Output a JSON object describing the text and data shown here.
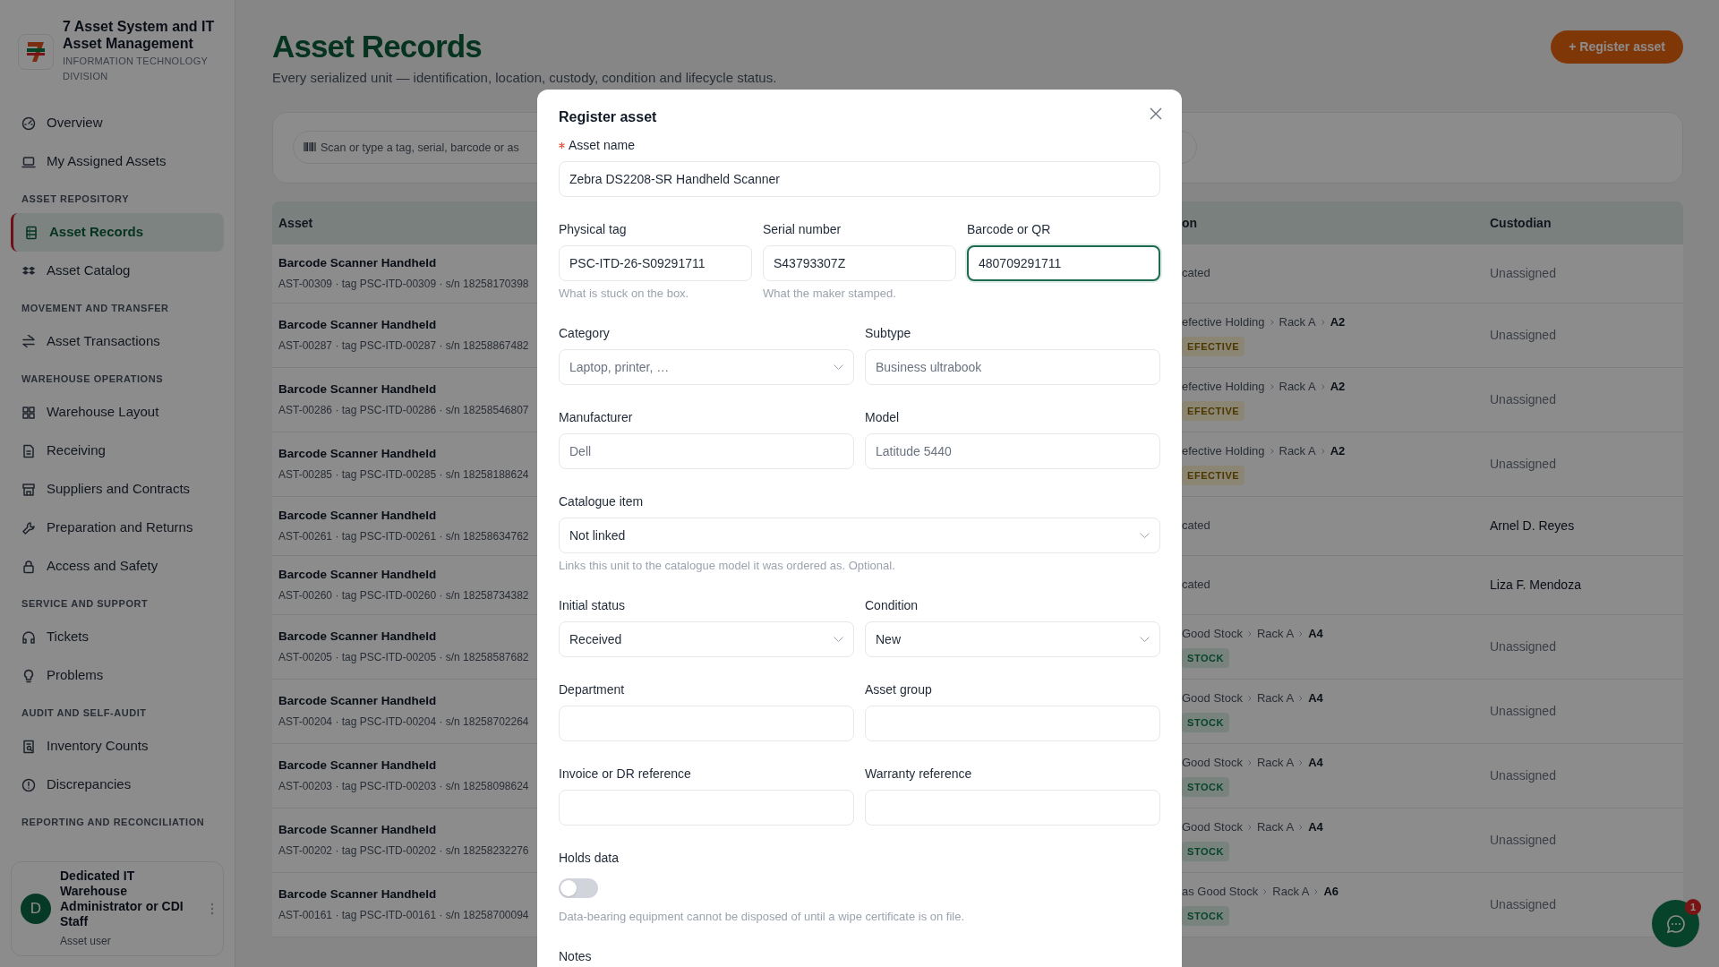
{
  "sidebar": {
    "brand": {
      "title": "7 Asset System and IT Asset Management",
      "subtitle": "INFORMATION TECHNOLOGY DIVISION"
    },
    "sections": [
      {
        "items": [
          {
            "label": "Overview",
            "selected": false
          },
          {
            "label": "My Assigned Assets",
            "selected": false
          }
        ]
      },
      {
        "heading": "ASSET REPOSITORY",
        "items": [
          {
            "label": "Asset Records",
            "selected": true
          },
          {
            "label": "Asset Catalog",
            "selected": false
          }
        ]
      },
      {
        "heading": "MOVEMENT AND TRANSFER",
        "items": [
          {
            "label": "Asset Transactions",
            "selected": false
          }
        ]
      },
      {
        "heading": "WAREHOUSE OPERATIONS",
        "items": [
          {
            "label": "Warehouse Layout",
            "selected": false
          },
          {
            "label": "Receiving",
            "selected": false
          },
          {
            "label": "Suppliers and Contracts",
            "selected": false
          },
          {
            "label": "Preparation and Returns",
            "selected": false
          },
          {
            "label": "Access and Safety",
            "selected": false
          }
        ]
      },
      {
        "heading": "SERVICE AND SUPPORT",
        "items": [
          {
            "label": "Tickets",
            "selected": false
          },
          {
            "label": "Problems",
            "selected": false
          }
        ]
      },
      {
        "heading": "AUDIT AND SELF-AUDIT",
        "items": [
          {
            "label": "Inventory Counts",
            "selected": false
          },
          {
            "label": "Discrepancies",
            "selected": false
          }
        ]
      },
      {
        "heading": "REPORTING AND RECONCILIATION"
      }
    ],
    "user": {
      "initial": "D",
      "name": "Dedicated IT Warehouse Administrator or CDI Staff",
      "role": "Asset user"
    }
  },
  "header": {
    "title": "Asset Records",
    "subtitle": "Every serialized unit — identification, location, custody, condition and lifecycle status.",
    "button": "+ Register asset"
  },
  "search": {
    "placeholder": "Scan or type a tag, serial, barcode or as"
  },
  "table": {
    "columns": [
      "Asset",
      "on",
      "Custodian"
    ],
    "rows": [
      {
        "name": "Barcode Scanner Handheld",
        "ids": "AST-00309 · tag PSC-ITD-00309 · s/n 18258170398",
        "location": [
          "cated"
        ],
        "custodian": "Unassigned",
        "assigned": false
      },
      {
        "name": "Barcode Scanner Handheld",
        "ids": "AST-00287 · tag PSC-ITD-00287 · s/n 18258867482",
        "location": [
          "efective Holding",
          "Rack A",
          "A2"
        ],
        "badge": {
          "text": "EFECTIVE",
          "kind": "defective"
        },
        "custodian": "Unassigned",
        "assigned": false
      },
      {
        "name": "Barcode Scanner Handheld",
        "ids": "AST-00286 · tag PSC-ITD-00286 · s/n 18258546807",
        "location": [
          "efective Holding",
          "Rack A",
          "A2"
        ],
        "badge": {
          "text": "EFECTIVE",
          "kind": "defective"
        },
        "custodian": "Unassigned",
        "assigned": false
      },
      {
        "name": "Barcode Scanner Handheld",
        "ids": "AST-00285 · tag PSC-ITD-00285 · s/n 18258188624",
        "location": [
          "efective Holding",
          "Rack A",
          "A2"
        ],
        "badge": {
          "text": "EFECTIVE",
          "kind": "defective"
        },
        "custodian": "Unassigned",
        "assigned": false
      },
      {
        "name": "Barcode Scanner Handheld",
        "ids": "AST-00261 · tag PSC-ITD-00261 · s/n 18258634762",
        "location": [
          "cated"
        ],
        "custodian": "Arnel D. Reyes",
        "assigned": true
      },
      {
        "name": "Barcode Scanner Handheld",
        "ids": "AST-00260 · tag PSC-ITD-00260 · s/n 18258734382",
        "location": [
          "cated"
        ],
        "custodian": "Liza F. Mendoza",
        "assigned": true
      },
      {
        "name": "Barcode Scanner Handheld",
        "ids": "AST-00205 · tag PSC-ITD-00205 · s/n 18258587682",
        "location": [
          "Good Stock",
          "Rack A",
          "A4"
        ],
        "badge": {
          "text": "STOCK",
          "kind": "stock"
        },
        "custodian": "Unassigned",
        "assigned": false
      },
      {
        "name": "Barcode Scanner Handheld",
        "ids": "AST-00204 · tag PSC-ITD-00204 · s/n 18258702264",
        "location": [
          "Good Stock",
          "Rack A",
          "A4"
        ],
        "badge": {
          "text": "STOCK",
          "kind": "stock"
        },
        "custodian": "Unassigned",
        "assigned": false
      },
      {
        "name": "Barcode Scanner Handheld",
        "ids": "AST-00203 · tag PSC-ITD-00203 · s/n 18258098624",
        "location": [
          "Good Stock",
          "Rack A",
          "A4"
        ],
        "badge": {
          "text": "STOCK",
          "kind": "stock"
        },
        "custodian": "Unassigned",
        "assigned": false
      },
      {
        "name": "Barcode Scanner Handheld",
        "ids": "AST-00202 · tag PSC-ITD-00202 · s/n 18258232276",
        "location": [
          "Good Stock",
          "Rack A",
          "A4"
        ],
        "badge": {
          "text": "STOCK",
          "kind": "stock"
        },
        "custodian": "Unassigned",
        "assigned": false
      },
      {
        "name": "Barcode Scanner Handheld",
        "ids": "AST-00161 · tag PSC-ITD-00161 · s/n 18258700094",
        "location": [
          "as Good Stock",
          "Rack A",
          "A6"
        ],
        "badge": {
          "text": "STOCK",
          "kind": "stock"
        },
        "custodian": "Unassigned",
        "assigned": false
      }
    ]
  },
  "modal": {
    "title": "Register asset",
    "rows": [
      [
        {
          "kind": "text",
          "label": "Asset name",
          "required": true,
          "focused": false,
          "value": "Zebra DS2208-SR Handheld Scanner"
        }
      ],
      [
        {
          "kind": "text",
          "label": "Physical tag",
          "focused": false,
          "value": "PSC-ITD-26-S09291711",
          "hint": "What is stuck on the box."
        },
        {
          "kind": "text",
          "label": "Serial number",
          "focused": false,
          "value": "S43793307Z",
          "hint": "What the maker stamped."
        },
        {
          "kind": "text",
          "label": "Barcode or QR",
          "focused": true,
          "value": "480709291711"
        }
      ],
      [
        {
          "kind": "select",
          "label": "Category",
          "focused": false,
          "placeholder": "Laptop, printer, …"
        },
        {
          "kind": "text",
          "label": "Subtype",
          "focused": false,
          "placeholder": "Business ultrabook"
        }
      ],
      [
        {
          "kind": "text",
          "label": "Manufacturer",
          "focused": false,
          "placeholder": "Dell"
        },
        {
          "kind": "text",
          "label": "Model",
          "focused": false,
          "placeholder": "Latitude 5440"
        }
      ],
      [
        {
          "kind": "select",
          "label": "Catalogue item",
          "focused": false,
          "value": "Not linked",
          "hint": "Links this unit to the catalogue model it was ordered as. Optional."
        }
      ],
      [
        {
          "kind": "select",
          "label": "Initial status",
          "focused": false,
          "value": "Received"
        },
        {
          "kind": "select",
          "label": "Condition",
          "focused": false,
          "value": "New"
        }
      ],
      [
        {
          "kind": "text",
          "label": "Department",
          "focused": false
        },
        {
          "kind": "text",
          "label": "Asset group",
          "focused": false
        }
      ],
      [
        {
          "kind": "text",
          "label": "Invoice or DR reference",
          "focused": false
        },
        {
          "kind": "text",
          "label": "Warranty reference",
          "focused": false
        }
      ],
      [
        {
          "kind": "toggle",
          "label": "Holds data",
          "on": false,
          "hint": "Data-bearing equipment cannot be disposed of until a wipe certificate is on file."
        }
      ],
      [
        {
          "kind": "heading",
          "label": "Notes"
        }
      ]
    ]
  },
  "chat": {
    "badge": "1"
  }
}
